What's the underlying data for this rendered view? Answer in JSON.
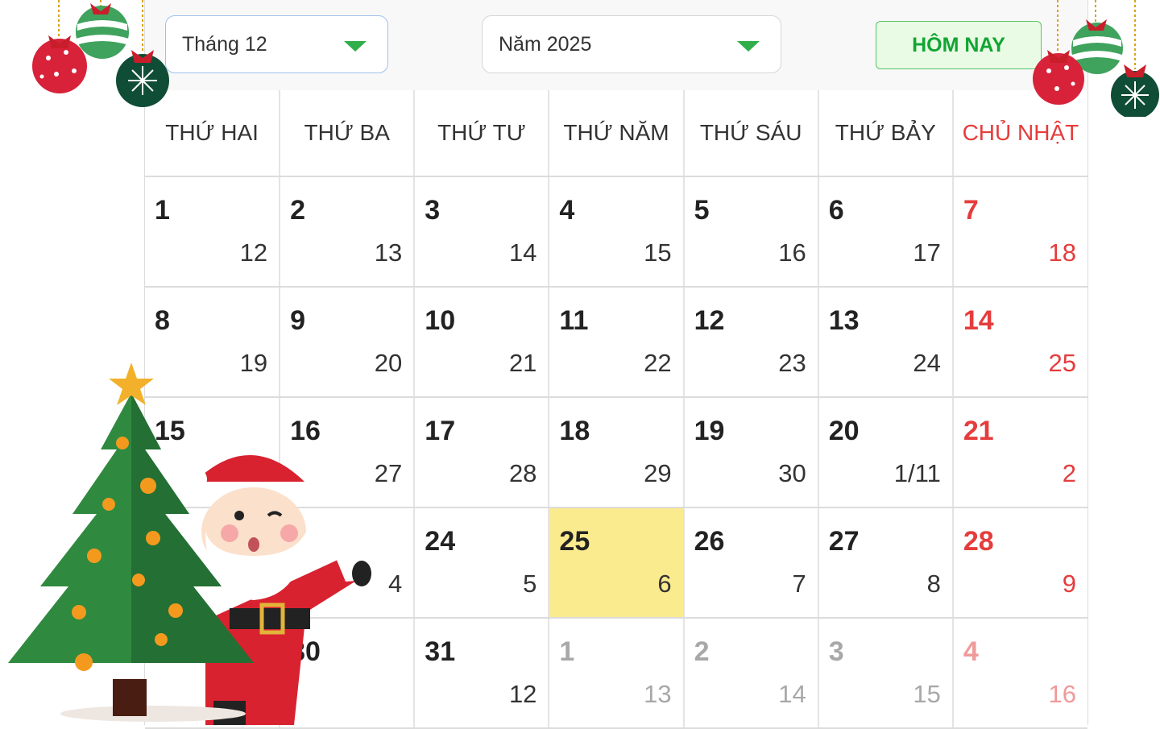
{
  "toolbar": {
    "month_select": "Tháng 12",
    "year_select": "Năm 2025",
    "today_label": "HÔM NAY"
  },
  "weekdays": [
    "THỨ HAI",
    "THỨ BA",
    "THỨ TƯ",
    "THỨ NĂM",
    "THỨ SÁU",
    "THỨ BẢY",
    "CHỦ NHẬT"
  ],
  "weeks": [
    [
      {
        "s": "1",
        "l": "12"
      },
      {
        "s": "2",
        "l": "13"
      },
      {
        "s": "3",
        "l": "14"
      },
      {
        "s": "4",
        "l": "15"
      },
      {
        "s": "5",
        "l": "16"
      },
      {
        "s": "6",
        "l": "17"
      },
      {
        "s": "7",
        "l": "18"
      }
    ],
    [
      {
        "s": "8",
        "l": "19"
      },
      {
        "s": "9",
        "l": "20"
      },
      {
        "s": "10",
        "l": "21"
      },
      {
        "s": "11",
        "l": "22"
      },
      {
        "s": "12",
        "l": "23"
      },
      {
        "s": "13",
        "l": "24"
      },
      {
        "s": "14",
        "l": "25"
      }
    ],
    [
      {
        "s": "15",
        "l": ""
      },
      {
        "s": "16",
        "l": "27"
      },
      {
        "s": "17",
        "l": "28"
      },
      {
        "s": "18",
        "l": "29"
      },
      {
        "s": "19",
        "l": "30"
      },
      {
        "s": "20",
        "l": "1/11"
      },
      {
        "s": "21",
        "l": "2"
      }
    ],
    [
      {
        "s": "",
        "l": ""
      },
      {
        "s": "",
        "l": "4"
      },
      {
        "s": "24",
        "l": "5"
      },
      {
        "s": "25",
        "l": "6"
      },
      {
        "s": "26",
        "l": "7"
      },
      {
        "s": "27",
        "l": "8"
      },
      {
        "s": "28",
        "l": "9"
      }
    ],
    [
      {
        "s": "",
        "l": ""
      },
      {
        "s": "30",
        "l": ""
      },
      {
        "s": "31",
        "l": "12"
      },
      {
        "s": "1",
        "l": "13"
      },
      {
        "s": "2",
        "l": "14"
      },
      {
        "s": "3",
        "l": "15"
      },
      {
        "s": "4",
        "l": "16"
      }
    ]
  ],
  "highlight": {
    "today_week": 3,
    "today_day": 3
  },
  "next_month_start": {
    "week": 4,
    "day": 3
  },
  "colors": {
    "sunday": "#e53c3c",
    "accent_green": "#12a533",
    "today_bg": "#fbeb8f",
    "muted": "#a8a8a8"
  },
  "decorations": [
    "christmas-ornament-icon",
    "christmas-tree-icon",
    "santa-claus-icon"
  ]
}
